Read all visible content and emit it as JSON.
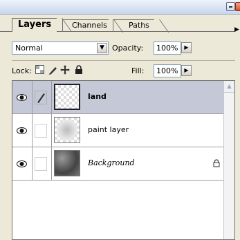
{
  "tabs": [
    {
      "label": "Layers",
      "active": true
    },
    {
      "label": "Channels",
      "active": false
    },
    {
      "label": "Paths",
      "active": false
    }
  ],
  "blend_mode": "Normal",
  "opacity": {
    "label": "Opacity:",
    "value": "100%"
  },
  "lock_label": "Lock:",
  "fill": {
    "label": "Fill:",
    "value": "100%"
  },
  "layers": [
    {
      "name": "land",
      "selected": true,
      "style": "bold",
      "brush": true,
      "locked": false
    },
    {
      "name": "paint layer",
      "selected": false,
      "style": "normal",
      "brush": false,
      "locked": false
    },
    {
      "name": "Background",
      "selected": false,
      "style": "italic",
      "brush": false,
      "locked": true
    }
  ],
  "colors": {
    "selected_row": "#c5c8d6",
    "panel_bg": "#ece9d8"
  }
}
